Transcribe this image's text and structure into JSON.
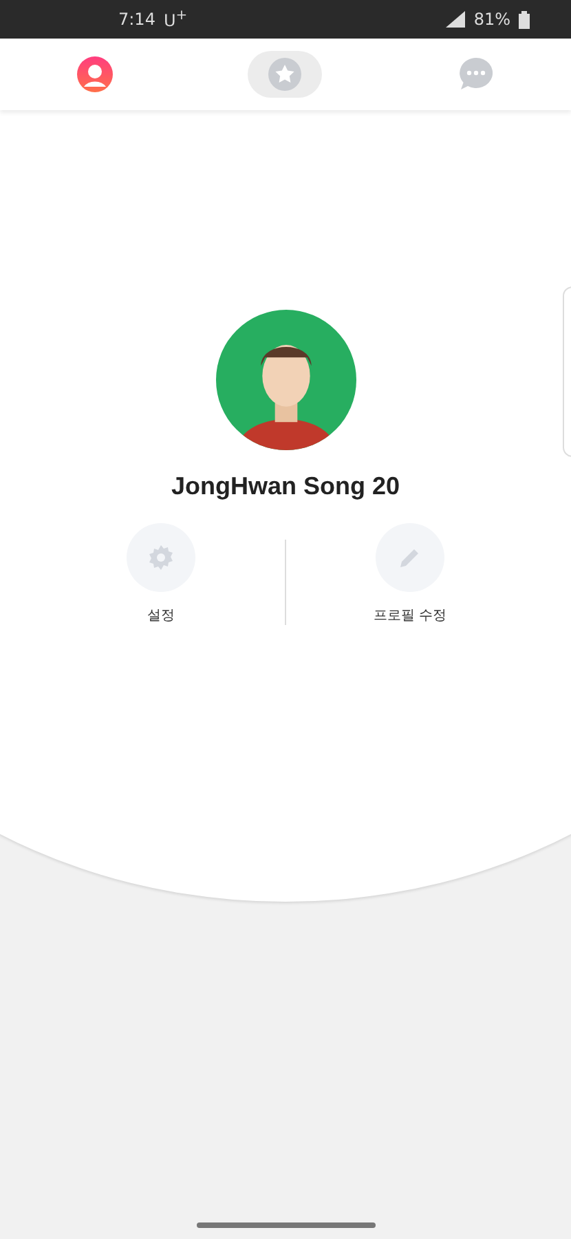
{
  "status_bar": {
    "time": "7:14",
    "carrier": "U$^{+}$",
    "battery": "81%"
  },
  "tabs": [
    {
      "kind": "profile",
      "selected": true,
      "highlighted": false
    },
    {
      "kind": "star",
      "selected": false,
      "highlighted": true
    },
    {
      "kind": "chat",
      "selected": false,
      "highlighted": false
    }
  ],
  "profile": {
    "name": "JongHwan Song 20"
  },
  "actions": [
    {
      "kind": "settings",
      "label": "설정"
    },
    {
      "kind": "edit",
      "label": "프로필 수정"
    }
  ]
}
